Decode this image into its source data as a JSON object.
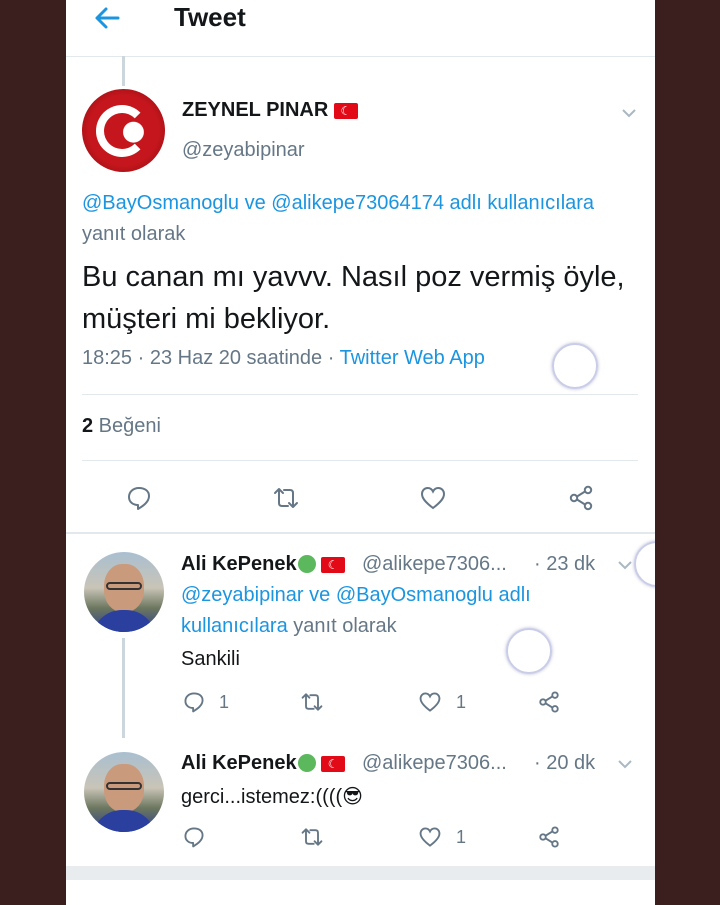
{
  "header": {
    "title": "Tweet"
  },
  "colors": {
    "accent": "#1b95e0",
    "text": "#14171a",
    "muted": "#657786",
    "border": "#e3e8ec"
  },
  "main_tweet": {
    "display_name": "ZEYNEL PINAR",
    "flag": "🇹🇷",
    "handle": "@zeyabipinar",
    "reply_mention_1": "@BayOsmanoglu",
    "reply_joiner": " ve ",
    "reply_mention_2": "@alikepe73064174",
    "reply_suffix_link": " adlı kullanıcılara",
    "reply_suffix": " yanıt olarak",
    "text": "Bu canan mı yavvv. Nasıl poz vermiş öyle, müşteri mi bekliyor.",
    "meta_time": "18:25 · 23 Haz 20 saatinde · ",
    "meta_source": "Twitter Web App",
    "likes_count": "2",
    "likes_label": " Beğeni"
  },
  "replies": [
    {
      "display_name": "Ali KePenek",
      "handle": "@alikepe7306...",
      "time": "· 23 dk",
      "reply_mention_1": "@zeyabipinar",
      "reply_joiner": " ve ",
      "reply_mention_2": "@BayOsmanoglu",
      "reply_suffix_link": " adlı kullanıcılara",
      "reply_suffix": " yanıt olarak",
      "text": "Sankili",
      "reply_count": "1",
      "like_count": "1"
    },
    {
      "display_name": "Ali KePenek",
      "handle": "@alikepe7306...",
      "time": "· 20 dk",
      "text": "gerci...istemez:((((😎",
      "like_count": "1"
    }
  ],
  "icons": [
    "back-arrow-icon",
    "chevron-down-icon",
    "reply-icon",
    "retweet-icon",
    "like-icon",
    "share-icon"
  ]
}
